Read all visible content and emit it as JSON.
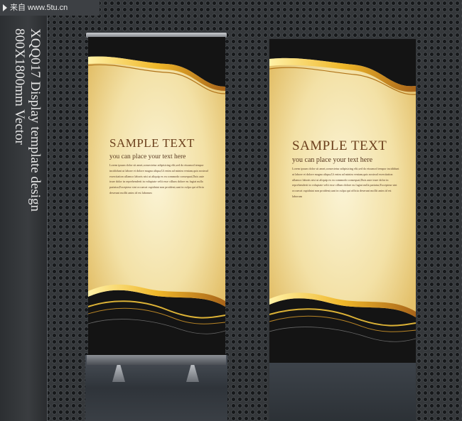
{
  "watermark": {
    "text": "来自 www.5tu.cn"
  },
  "side_title": {
    "line1": "XQQ017 Display template design",
    "line2": "800X1800mm Vector"
  },
  "banners": [
    {
      "heading": "SAMPLE TEXT",
      "subheading": "you can place your text here",
      "body": "Lorem ipsum dolor sit amet,consectetur adipisicing elit,sed do eiusmod tempor incididunt ut labore et dolore magna aliqua,Ut enim ad minim veniam,quis nostrud exercitation ullamco laboris nisi ut aliquip ex ea commodo consequat,Duis aute irure dolor in reprehenderit in voluptate velit esse cillum dolore eu fugiat nulla pariatur,Excepteur sint occaecat cupidatat non proident,sunt in culpa qui officia deserunt mollit anim id est laborum"
    },
    {
      "heading": "SAMPLE TEXT",
      "subheading": "you can place your text here",
      "body": "Lorem ipsum dolor sit amet,consectetur adipisicing elit,sed do eiusmod tempor incididunt ut labore et dolore magna aliqua,Ut enim ad minim veniam,quis nostrud exercitation ullamco laboris nisi ut aliquip ex ea commodo consequat,Duis aute irure dolor in reprehenderit in voluptate velit esse cillum dolore eu fugiat nulla pariatur,Excepteur sint occaecat cupidatat non proident,sunt in culpa qui officia deserunt mollit anim id est laborum"
    }
  ],
  "colors": {
    "gold": "#f2c33a",
    "cream": "#f6e8b8",
    "dark": "#151515",
    "brown": "#6b3f1c"
  }
}
